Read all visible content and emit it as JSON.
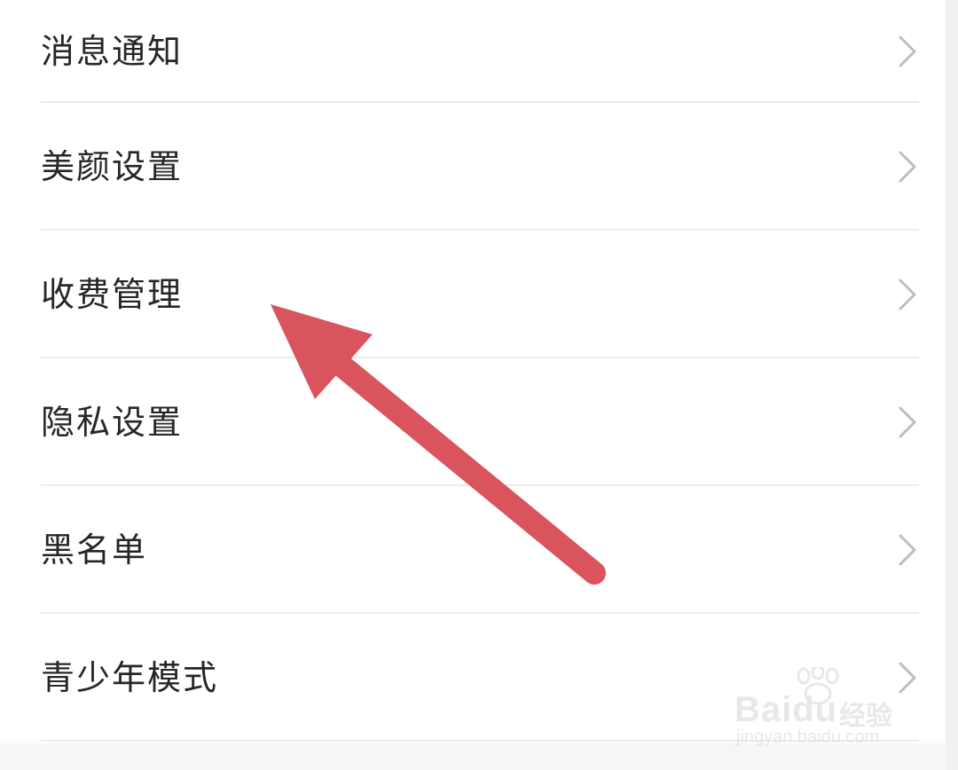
{
  "settings_menu": {
    "items": [
      {
        "label": "消息通知"
      },
      {
        "label": "美颜设置"
      },
      {
        "label": "收费管理"
      },
      {
        "label": "隐私设置"
      },
      {
        "label": "黑名单"
      },
      {
        "label": "青少年模式"
      }
    ]
  },
  "annotation": {
    "arrow_color": "#d9545d",
    "points_to": "收费管理"
  },
  "watermark": {
    "brand": "Baidu",
    "cn": "经验",
    "url": "jingyan.baidu.com"
  },
  "colors": {
    "text": "#262626",
    "divider": "#ececec",
    "chevron": "#bdbdbd"
  }
}
